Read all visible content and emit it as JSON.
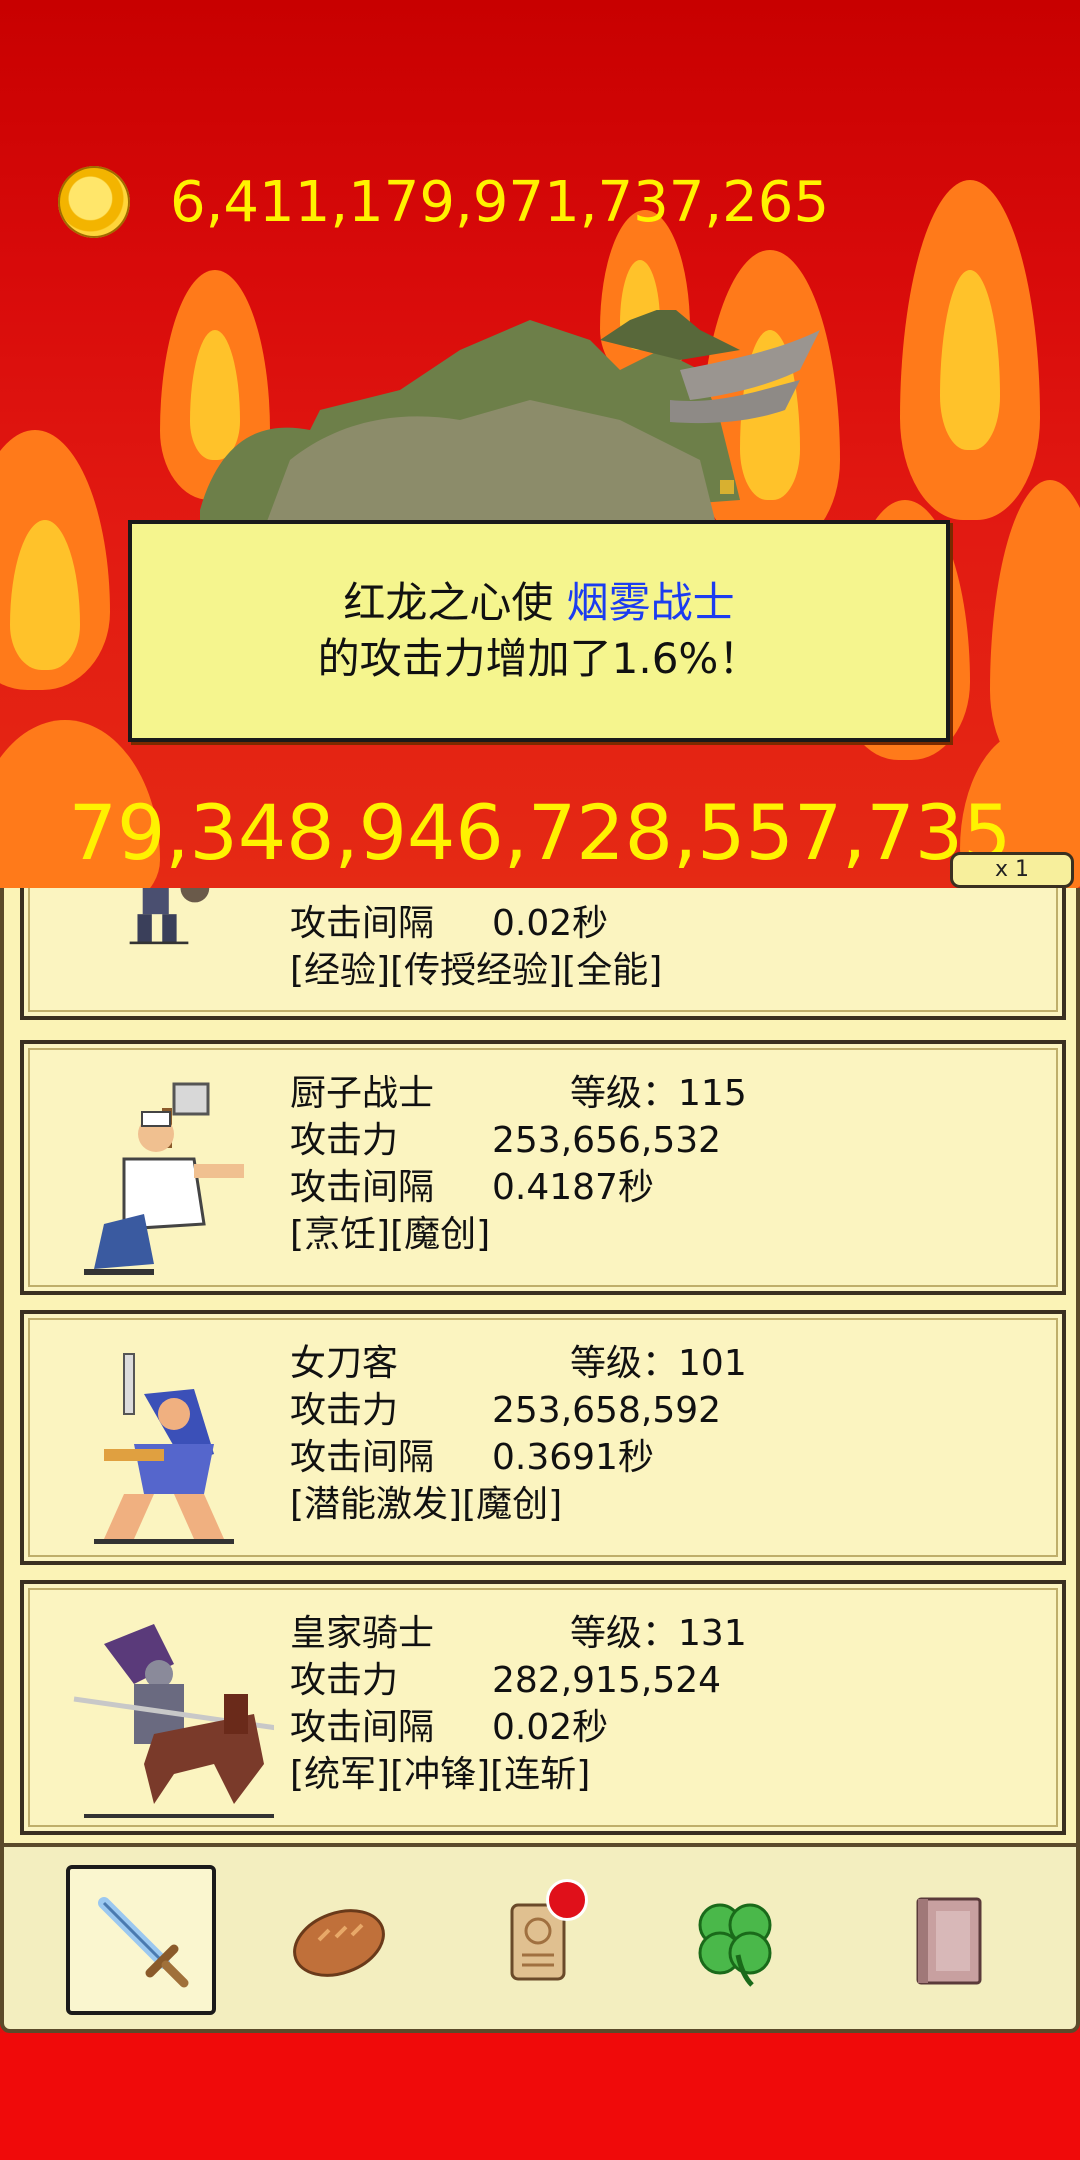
{
  "gold": "6,411,179,971,737,265",
  "notice": {
    "prefix": "红龙之心使 ",
    "name": "烟雾战士",
    "line2": "的攻击力增加了1.6%！"
  },
  "damage": "79,348,946,728,557,735",
  "speed": "x 1",
  "labels": {
    "level": "等级：",
    "attack": "攻击力",
    "interval": "攻击间隔"
  },
  "warriors": [
    {
      "name": "",
      "level": "",
      "attack": "",
      "interval": "0.02秒",
      "skills": "[经验][传授经验][全能]"
    },
    {
      "name": "厨子战士",
      "level": "115",
      "attack": "253,656,532",
      "interval": "0.4187秒",
      "skills": "[烹饪][魔创]"
    },
    {
      "name": "女刀客",
      "level": "101",
      "attack": "253,658,592",
      "interval": "0.3691秒",
      "skills": "[潜能激发][魔创]"
    },
    {
      "name": "皇家骑士",
      "level": "131",
      "attack": "282,915,524",
      "interval": "0.02秒",
      "skills": "[统军][冲锋][连斩]"
    }
  ],
  "nav": [
    {
      "icon": "sword-icon",
      "selected": true
    },
    {
      "icon": "bread-icon",
      "selected": false
    },
    {
      "icon": "scroll-icon",
      "selected": false,
      "badge": true
    },
    {
      "icon": "clover-icon",
      "selected": false
    },
    {
      "icon": "book-icon",
      "selected": false
    }
  ],
  "colors": {
    "gold_text": "#fff200",
    "notice_bg": "#f5f58e",
    "highlight_name": "#1c3cf0",
    "panel_bg": "#fbf3b6"
  }
}
